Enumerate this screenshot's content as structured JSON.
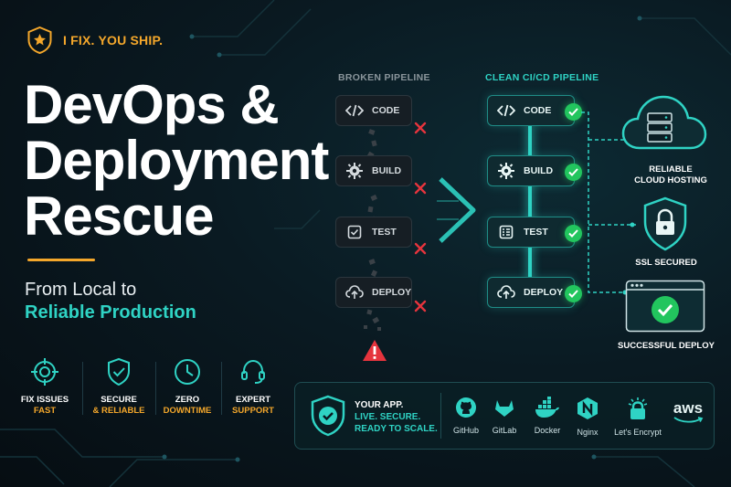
{
  "brand": {
    "tagline": "I FIX. YOU SHIP.",
    "badge_icon": "star-shield-icon",
    "accent": "#f4a72b"
  },
  "headline": {
    "line1": "DevOps &",
    "line2": "Deployment",
    "line3": "Rescue"
  },
  "subheading": {
    "line1": "From Local to",
    "line2": "Reliable Production"
  },
  "features": [
    {
      "icon": "target-icon",
      "line1": "FIX ISSUES",
      "line2": "FAST"
    },
    {
      "icon": "shield-check-icon",
      "line1": "SECURE",
      "line2": "& RELIABLE"
    },
    {
      "icon": "clock-icon",
      "line1": "ZERO",
      "line2": "DOWNTIME"
    },
    {
      "icon": "headset-icon",
      "line1": "EXPERT",
      "line2": "SUPPORT"
    }
  ],
  "broken_pipeline": {
    "title": "BROKEN PIPELINE",
    "steps": [
      {
        "label": "CODE",
        "icon": "code-icon",
        "status": "failed"
      },
      {
        "label": "BUILD",
        "icon": "gear-icon",
        "status": "failed"
      },
      {
        "label": "TEST",
        "icon": "checklist-icon",
        "status": "failed"
      },
      {
        "label": "DEPLOY",
        "icon": "cloud-upload-icon",
        "status": "failed"
      }
    ],
    "end_icon": "warning-icon"
  },
  "clean_pipeline": {
    "title": "CLEAN CI/CD PIPELINE",
    "steps": [
      {
        "label": "CODE",
        "icon": "code-icon",
        "status": "passed"
      },
      {
        "label": "BUILD",
        "icon": "gear-icon",
        "status": "passed"
      },
      {
        "label": "TEST",
        "icon": "checklist-icon",
        "status": "passed"
      },
      {
        "label": "DEPLOY",
        "icon": "cloud-upload-icon",
        "status": "passed"
      }
    ]
  },
  "outputs": [
    {
      "icon": "cloud-server-icon",
      "line1": "RELIABLE",
      "line2": "CLOUD HOSTING"
    },
    {
      "icon": "lock-shield-icon",
      "line1": "SSL SECURED"
    },
    {
      "icon": "browser-check-icon",
      "line1": "SUCCESSFUL DEPLOY"
    }
  ],
  "banner": {
    "icon": "shield-check-icon",
    "line1": "YOUR APP.",
    "line2": "LIVE. SECURE.",
    "line3": "READY TO SCALE.",
    "tools": [
      {
        "name": "GitHub",
        "icon": "github-icon"
      },
      {
        "name": "GitLab",
        "icon": "gitlab-icon"
      },
      {
        "name": "Docker",
        "icon": "docker-icon"
      },
      {
        "name": "Nginx",
        "icon": "nginx-icon"
      },
      {
        "name": "Let's Encrypt",
        "icon": "lets-encrypt-icon"
      },
      {
        "name": "aws",
        "icon": "aws-icon"
      }
    ]
  },
  "colors": {
    "teal": "#2fd3c4",
    "gold": "#f4a72b",
    "success": "#22c55e",
    "error": "#e5343d"
  }
}
